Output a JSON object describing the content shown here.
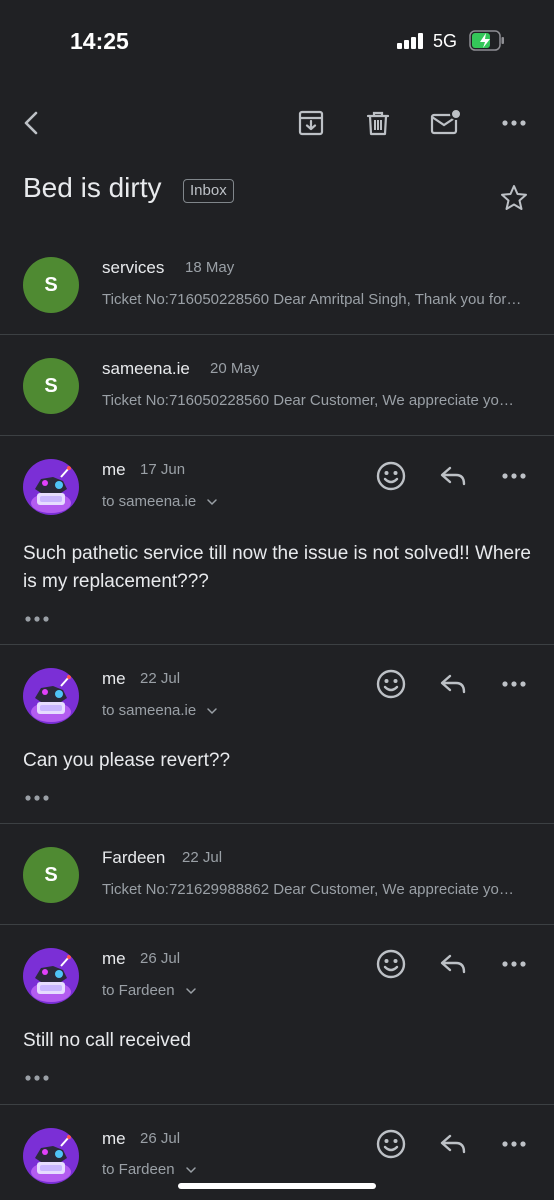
{
  "status_bar": {
    "time": "14:25",
    "network": "5G"
  },
  "toolbar": {
    "back_icon": "chevron-left-icon",
    "archive_icon": "archive-icon",
    "delete_icon": "trash-icon",
    "mark_unread_icon": "mail-unread-icon",
    "more_icon": "more-horizontal-icon"
  },
  "thread": {
    "subject": "Bed is dirty",
    "label": "Inbox"
  },
  "messages": [
    {
      "sender": "services",
      "avatar_letter": "S",
      "date": "18 May",
      "snippet": "Ticket No:716050228560 Dear Amritpal Singh, Thank you for contacting us"
    },
    {
      "sender": "sameena.ie",
      "avatar_letter": "S",
      "date": "20 May",
      "snippet": "Ticket No:716050228560 Dear Customer, We appreciate your patience"
    },
    {
      "sender": "me",
      "date": "17 Jun",
      "to": "to sameena.ie",
      "body": "Such pathetic service till now the issue is not solved!! Where is my replacement???"
    },
    {
      "sender": "me",
      "date": "22 Jul",
      "to": "to sameena.ie",
      "body": "Can you please revert??"
    },
    {
      "sender": "Fardeen",
      "avatar_letter": "S",
      "date": "22 Jul",
      "snippet": "Ticket No:721629988862 Dear Customer, We appreciate your patience"
    },
    {
      "sender": "me",
      "date": "26 Jul",
      "to": "to Fardeen",
      "body": "Still no call received"
    },
    {
      "sender": "me",
      "date": "26 Jul",
      "to": "to Fardeen"
    }
  ],
  "colors": {
    "background": "#202124",
    "avatar_green": "#4f8a32",
    "avatar_purple": "#7b2fd6",
    "divider": "#3c4043"
  }
}
